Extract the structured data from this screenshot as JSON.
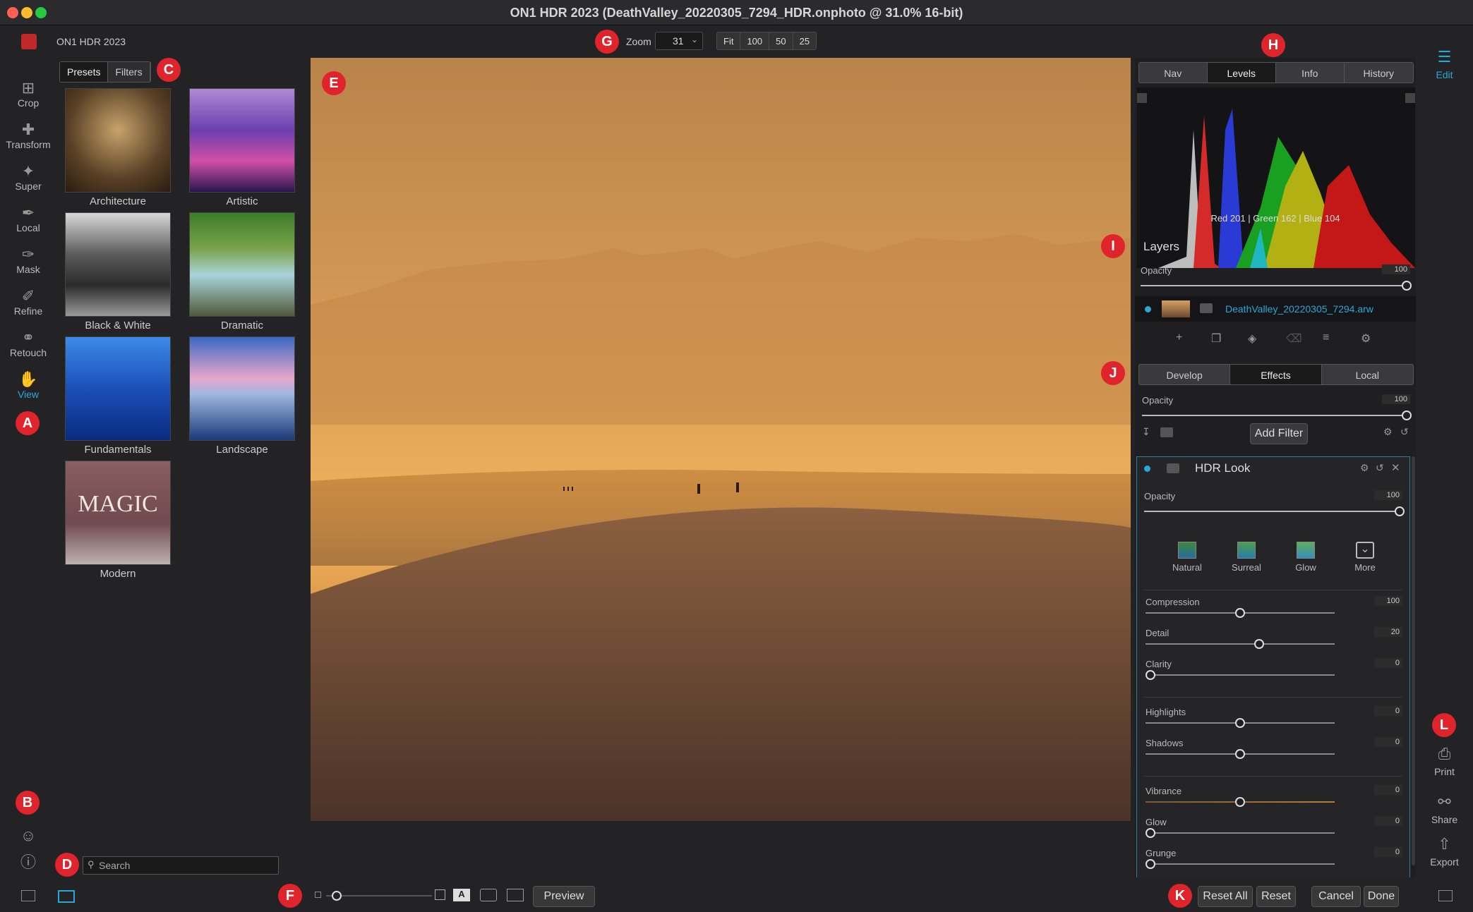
{
  "window": {
    "title": "ON1 HDR 2023 (DeathValley_20220305_7294_HDR.onphoto @ 31.0% 16-bit)"
  },
  "toolbar": {
    "app_name": "ON1 HDR 2023",
    "zoom_label": "Zoom",
    "zoom_value": "31",
    "zoom_buttons": [
      "Fit",
      "100",
      "50",
      "25"
    ]
  },
  "tools": [
    {
      "label": "Crop",
      "icon": "crop-icon"
    },
    {
      "label": "Transform",
      "icon": "transform-icon"
    },
    {
      "label": "Super",
      "icon": "super-icon"
    },
    {
      "label": "Local",
      "icon": "local-brush-icon"
    },
    {
      "label": "Mask",
      "icon": "mask-brush-icon"
    },
    {
      "label": "Refine",
      "icon": "refine-brush-icon"
    },
    {
      "label": "Retouch",
      "icon": "retouch-icon"
    },
    {
      "label": "View",
      "icon": "view-hand-icon"
    }
  ],
  "preset_tabs": [
    "Presets",
    "Filters"
  ],
  "presets": [
    "Architecture",
    "Artistic",
    "Black & White",
    "Dramatic",
    "Fundamentals",
    "Landscape",
    "Modern"
  ],
  "modern_thumb_text": "MAGIC",
  "search": {
    "placeholder": "Search"
  },
  "markers": [
    "A",
    "B",
    "C",
    "D",
    "E",
    "F",
    "G",
    "H",
    "I",
    "J",
    "K",
    "L"
  ],
  "right": {
    "top_tabs": [
      "Nav",
      "Levels",
      "Info",
      "History"
    ],
    "active_top_tab": "Levels",
    "histogram_readout": "Red 201 | Green 162 | Blue 104",
    "layers_title": "Layers",
    "opacity_label": "Opacity",
    "layers_opacity": "100",
    "layer_name": "DeathValley_20220305_7294.arw",
    "module_tabs": [
      "Develop",
      "Effects",
      "Local"
    ],
    "active_module_tab": "Effects",
    "effects_opacity": "100",
    "add_filter": "Add Filter",
    "filter_name": "HDR Look",
    "filter_opacity": "100",
    "look_styles": [
      "Natural",
      "Surreal",
      "Glow",
      "More"
    ],
    "sliders": [
      {
        "label": "Compression",
        "value": "100",
        "level": 0.5
      },
      {
        "label": "Detail",
        "value": "20",
        "level": 0.6
      },
      {
        "label": "Clarity",
        "value": "0",
        "level": 0.0
      },
      {
        "label": "Highlights",
        "value": "0",
        "level": 0.5
      },
      {
        "label": "Shadows",
        "value": "0",
        "level": 0.5
      },
      {
        "label": "Vibrance",
        "value": "0",
        "level": 0.5
      },
      {
        "label": "Glow",
        "value": "0",
        "level": 0.0
      },
      {
        "label": "Grunge",
        "value": "0",
        "level": 0.0
      }
    ]
  },
  "right_strip": [
    {
      "label": "Edit",
      "icon": "sliders-icon"
    },
    {
      "label": "Print",
      "icon": "printer-icon"
    },
    {
      "label": "Share",
      "icon": "share-icon"
    },
    {
      "label": "Export",
      "icon": "export-icon"
    }
  ],
  "bottom": {
    "preview": "Preview",
    "reset_all": "Reset All",
    "reset": "Reset",
    "cancel": "Cancel",
    "done": "Done"
  },
  "colors": {
    "accent": "#2aa7d8",
    "marker": "#e0242b",
    "layer_text": "#2aa7d8"
  }
}
